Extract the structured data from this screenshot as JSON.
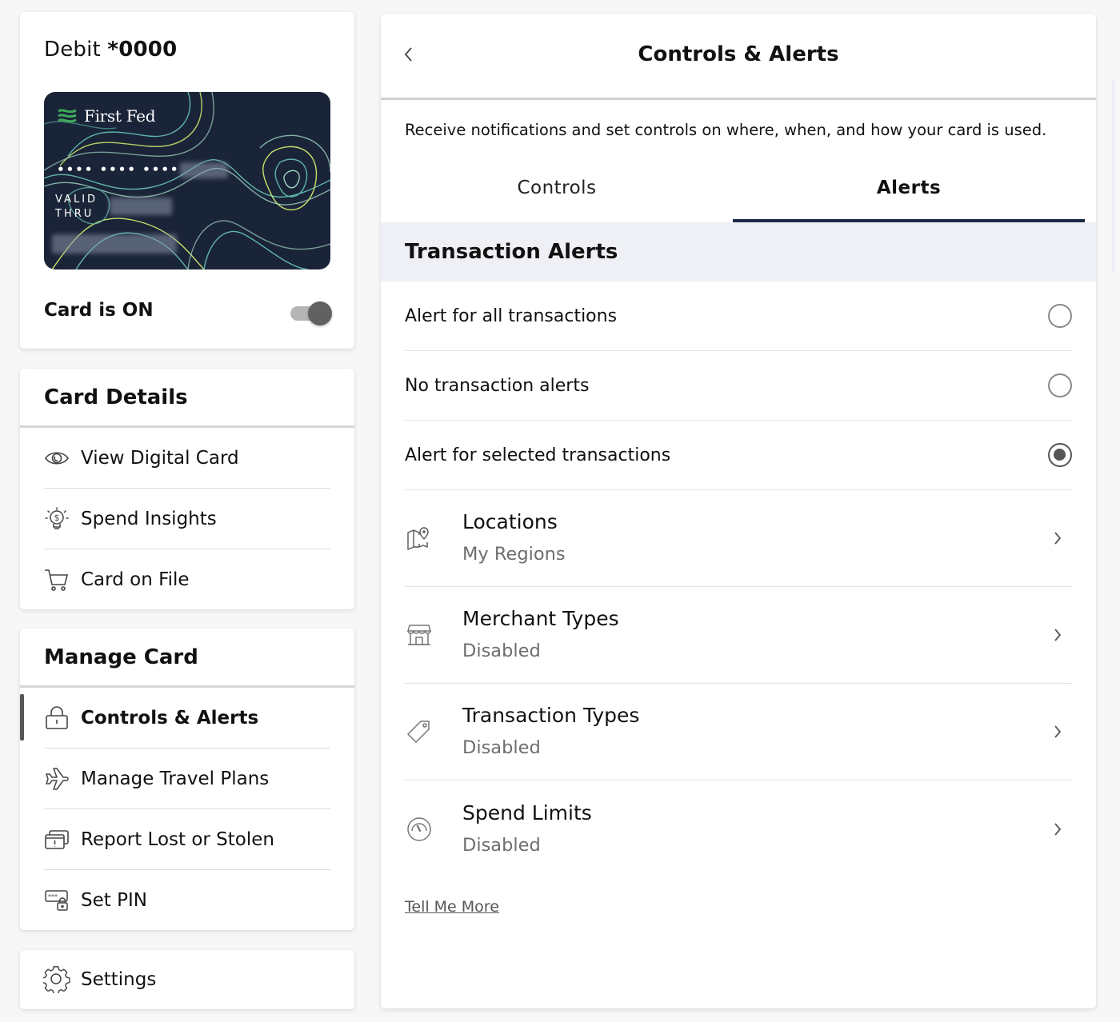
{
  "card": {
    "title_prefix": "Debit ",
    "title_number": "*0000",
    "brand": "First Fed",
    "masked_number": "•••• •••• ••••",
    "valid_thru_line1": "VALID",
    "valid_thru_line2": "THRU",
    "status_label": "Card is ON",
    "is_on": true,
    "colors": {
      "card_bg": "#1a2438",
      "logo_green": "#3fa95a",
      "topo_lines": [
        "#9fd4c2",
        "#c7e16b",
        "#5fb5a8"
      ]
    }
  },
  "card_details": {
    "heading": "Card Details",
    "items": [
      {
        "label": "View Digital Card",
        "icon": "eye-icon"
      },
      {
        "label": "Spend Insights",
        "icon": "lightbulb-dollar-icon"
      },
      {
        "label": "Card on File",
        "icon": "shopping-cart-icon"
      }
    ]
  },
  "manage_card": {
    "heading": "Manage Card",
    "items": [
      {
        "label": "Controls & Alerts",
        "icon": "lock-icon",
        "active": true
      },
      {
        "label": "Manage Travel Plans",
        "icon": "airplane-icon",
        "active": false
      },
      {
        "label": "Report Lost or Stolen",
        "icon": "card-alert-icon",
        "active": false
      },
      {
        "label": "Set PIN",
        "icon": "pin-lock-icon",
        "active": false
      }
    ]
  },
  "settings": {
    "label": "Settings",
    "icon": "gear-icon"
  },
  "main": {
    "title": "Controls & Alerts",
    "back_icon": "chevron-left-icon",
    "intro": "Receive notifications and set controls on where, when, and how your card is used.",
    "tabs": [
      {
        "label": "Controls",
        "active": false
      },
      {
        "label": "Alerts",
        "active": true
      }
    ],
    "accent_color": "#1b2a47",
    "section_title": "Transaction Alerts",
    "radio_options": [
      {
        "label": "Alert for all transactions",
        "checked": false
      },
      {
        "label": "No transaction alerts",
        "checked": false
      },
      {
        "label": "Alert for selected transactions",
        "checked": true
      }
    ],
    "links": [
      {
        "title": "Locations",
        "value": "My Regions",
        "icon": "map-pin-icon"
      },
      {
        "title": "Merchant Types",
        "value": "Disabled",
        "icon": "storefront-icon"
      },
      {
        "title": "Transaction Types",
        "value": "Disabled",
        "icon": "tag-icon"
      },
      {
        "title": "Spend Limits",
        "value": "Disabled",
        "icon": "gauge-icon"
      }
    ],
    "more_link": "Tell Me More"
  }
}
